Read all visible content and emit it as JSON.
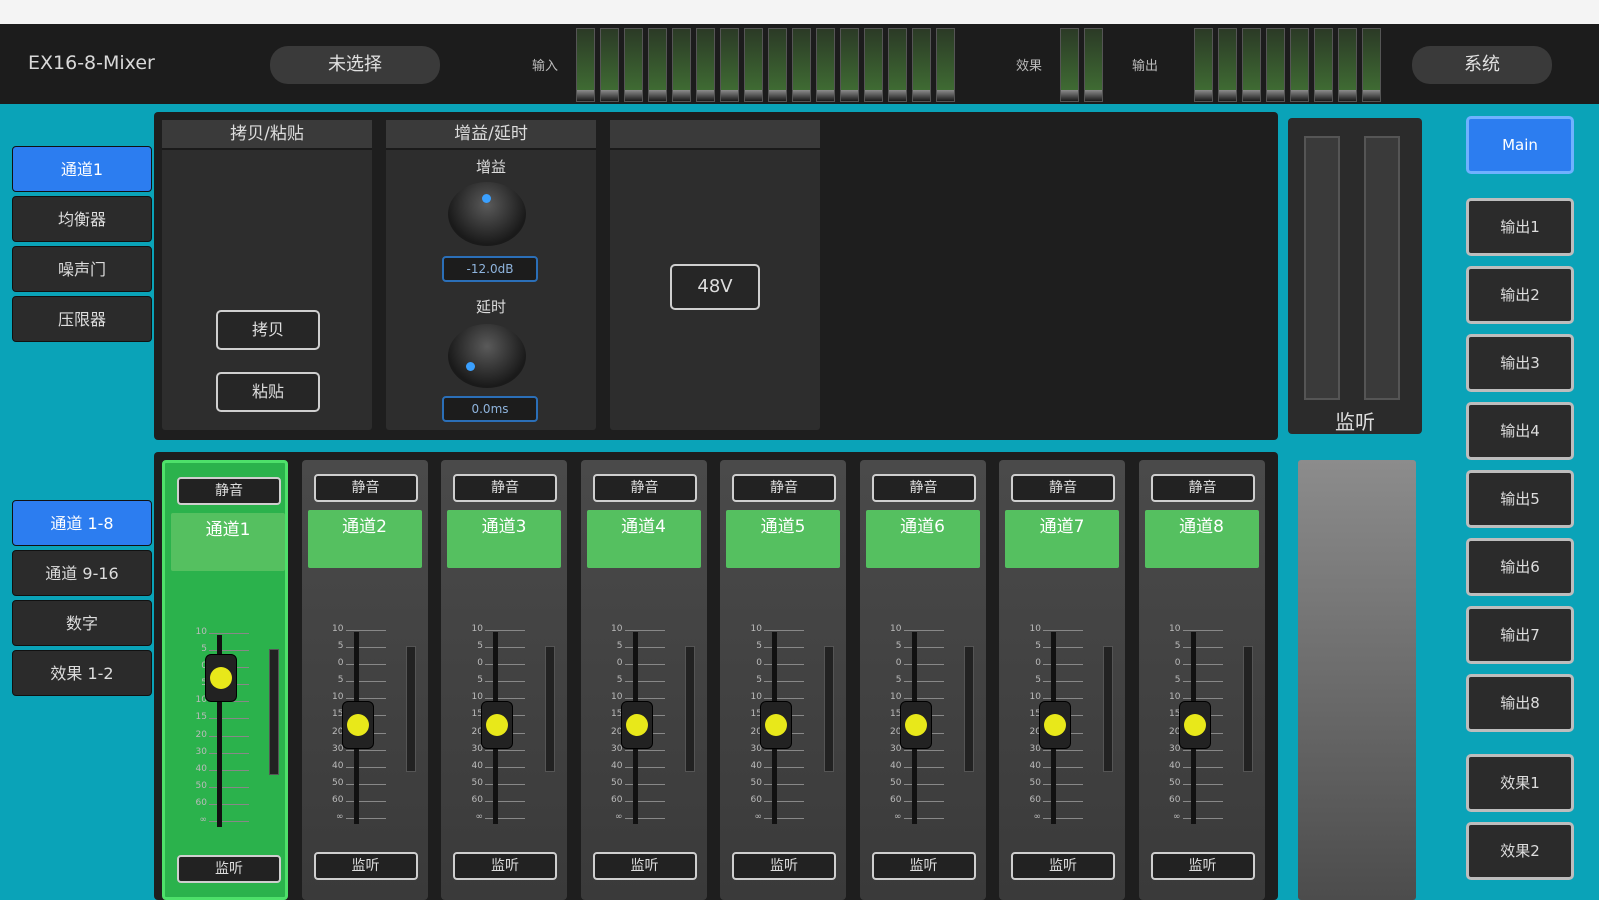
{
  "app": {
    "title": "EX16-8-Mixer"
  },
  "header": {
    "scene_label": "未选择",
    "input_label": "输入",
    "fx_label": "效果",
    "output_label": "输出",
    "system_label": "系统"
  },
  "left_nav_top": [
    "通道1",
    "均衡器",
    "噪声门",
    "压限器"
  ],
  "left_nav_bottom": [
    "通道 1-8",
    "通道 9-16",
    "数字",
    "效果 1-2"
  ],
  "panels": {
    "copy_paste": {
      "title": "拷贝/粘贴",
      "copy_label": "拷贝",
      "paste_label": "粘贴"
    },
    "gain_delay": {
      "title": "增益/延时",
      "gain_label": "增益",
      "gain_value": "-12.0dB",
      "delay_label": "延时",
      "delay_value": "0.0ms"
    },
    "phantom": {
      "button_label": "48V"
    }
  },
  "fader_scale": [
    "10",
    "5",
    "0",
    "5",
    "10",
    "15",
    "20",
    "30",
    "40",
    "50",
    "60",
    "∞"
  ],
  "channels": [
    {
      "name": "通道1",
      "mute": "静音",
      "listen": "监听",
      "level": 0.78
    },
    {
      "name": "通道2",
      "mute": "静音",
      "listen": "监听",
      "level": 0.52
    },
    {
      "name": "通道3",
      "mute": "静音",
      "listen": "监听",
      "level": 0.52
    },
    {
      "name": "通道4",
      "mute": "静音",
      "listen": "监听",
      "level": 0.52
    },
    {
      "name": "通道5",
      "mute": "静音",
      "listen": "监听",
      "level": 0.52
    },
    {
      "name": "通道6",
      "mute": "静音",
      "listen": "监听",
      "level": 0.52
    },
    {
      "name": "通道7",
      "mute": "静音",
      "listen": "监听",
      "level": 0.52
    },
    {
      "name": "通道8",
      "mute": "静音",
      "listen": "监听",
      "level": 0.52
    }
  ],
  "monitor": {
    "label": "监听"
  },
  "outputs": [
    "Main",
    "输出1",
    "输出2",
    "输出3",
    "输出4",
    "输出5",
    "输出6",
    "输出7",
    "输出8",
    "效果1",
    "效果2"
  ],
  "colors": {
    "accent": "#0aa3b8",
    "active": "#2c7df0",
    "channel_green": "#55c060",
    "fader_cap": "#e8e81a"
  },
  "icons": [
    "fader-knob-icon",
    "gain-knob-icon",
    "delay-knob-icon"
  ]
}
